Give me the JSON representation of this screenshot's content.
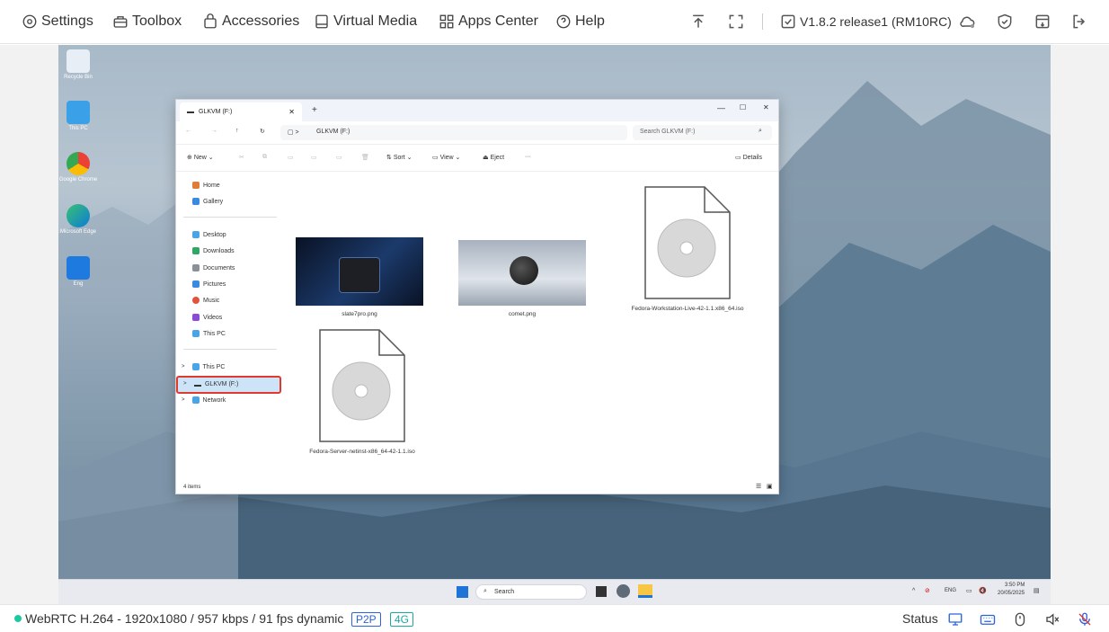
{
  "menu": {
    "settings": "Settings",
    "toolbox": "Toolbox",
    "accessories": "Accessories",
    "virtual_media": "Virtual Media",
    "apps_center": "Apps Center",
    "help": "Help"
  },
  "version": "V1.8.2 release1 (RM10RC)",
  "desktop_icons": [
    "Recycle Bin",
    "This PC",
    "Google Chrome",
    "Microsoft Edge",
    "Eng"
  ],
  "explorer": {
    "tab_title": "GLKVM (F:)",
    "address": "GLKVM (F:)",
    "search_placeholder": "Search GLKVM (F:)",
    "toolbar": {
      "new": "New",
      "sort": "Sort",
      "view": "View",
      "eject": "Eject",
      "more": "···",
      "details": "Details"
    },
    "nav": {
      "home": "Home",
      "gallery": "Gallery",
      "desktop": "Desktop",
      "downloads": "Downloads",
      "documents": "Documents",
      "pictures": "Pictures",
      "music": "Music",
      "videos": "Videos",
      "this_pc_pinned": "This PC",
      "this_pc": "This PC",
      "glkvm": "GLKVM (F:)",
      "network": "Network"
    },
    "files": [
      "slate7pro.png",
      "comet.png",
      "Fedora-Workstation-Live-42-1.1.x86_64.iso",
      "Fedora-Server-netinst-x86_64-42-1.1.iso"
    ],
    "item_count": "4 items"
  },
  "taskbar": {
    "search": "Search",
    "lang": "ENG",
    "time": "3:50 PM",
    "date": "20/05/2025"
  },
  "status": {
    "stream": "WebRTC H.264 - 1920x1080 / 957 kbps / 91 fps dynamic",
    "p2p": "P2P",
    "net": "4G",
    "status_label": "Status"
  },
  "colors": {
    "accent": "#2b63d9",
    "status_dot": "#1ec8a0",
    "highlight": "#e03a2f"
  }
}
